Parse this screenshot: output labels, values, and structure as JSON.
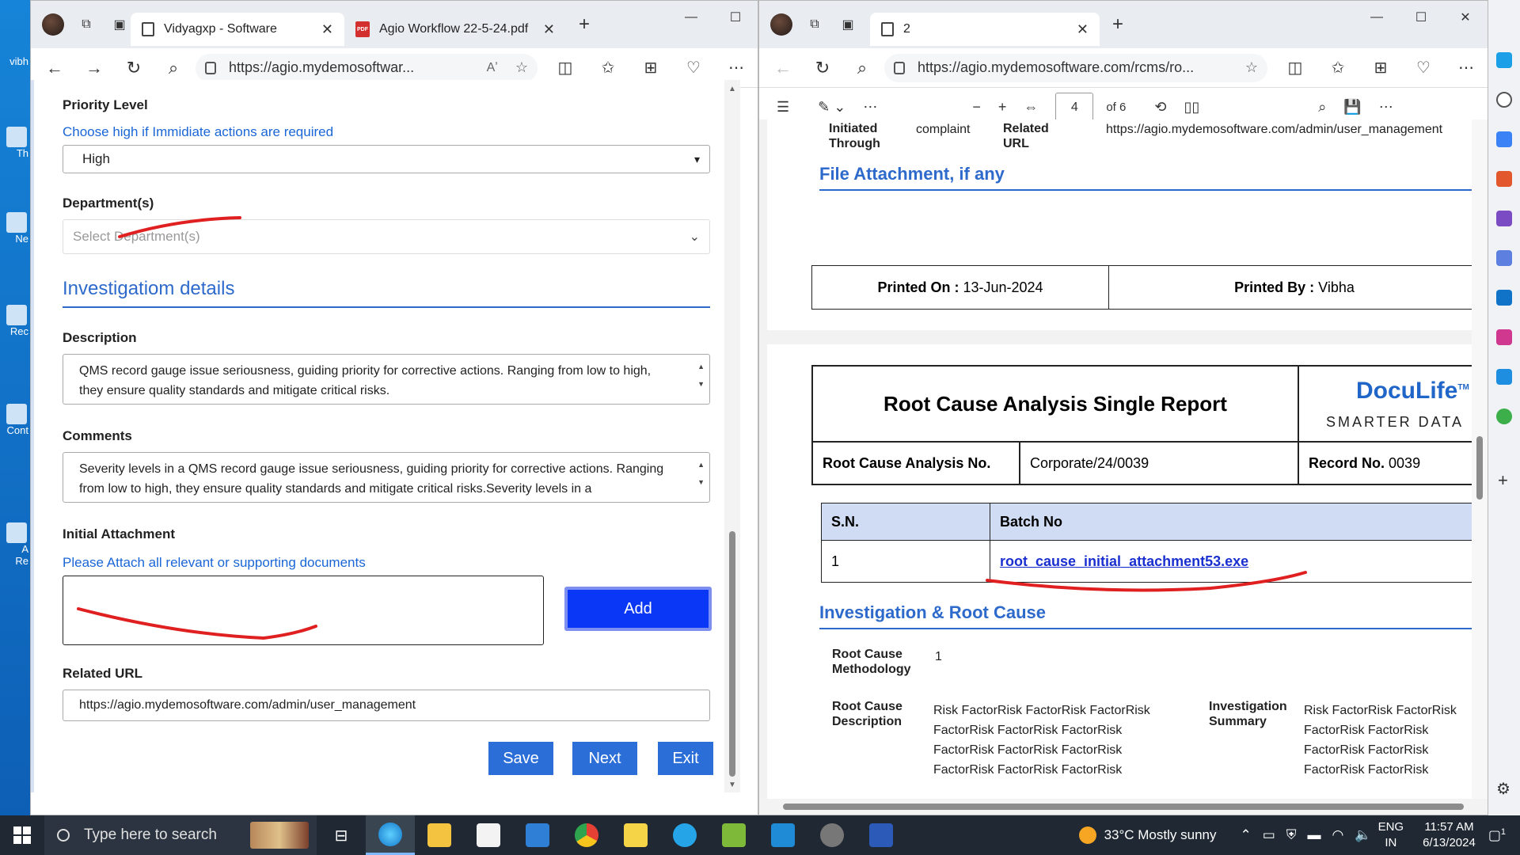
{
  "desktop": {
    "icons": [
      {
        "label": "vibh"
      },
      {
        "label": "Th"
      },
      {
        "label": "Ne"
      },
      {
        "label": "Rec"
      },
      {
        "label": "Cont"
      },
      {
        "label": "A"
      },
      {
        "label": "Re"
      }
    ]
  },
  "left_browser": {
    "tabs": [
      {
        "label": "Vidyagxp - Software",
        "close": "✕"
      },
      {
        "label": "Agio Workflow 22-5-24.pdf",
        "close": "✕"
      }
    ],
    "url": "https://agio.mydemosoftwar...",
    "form": {
      "priority_label": "Priority Level",
      "priority_hint": "Choose high if Immidiate actions are required",
      "priority_value": "High",
      "department_label": "Department(s)",
      "department_placeholder": "Select Department(s)",
      "section_title": "Investigatiom details",
      "description_label": "Description",
      "description_text": "QMS record gauge issue seriousness, guiding priority for corrective actions. Ranging from low to high, they ensure quality standards and mitigate critical risks.",
      "comments_label": "Comments",
      "comments_text": "Severity levels in a QMS record gauge issue seriousness, guiding priority for corrective actions. Ranging from low to high, they ensure quality standards and mitigate critical risks.Severity levels in a",
      "attachment_label": "Initial Attachment",
      "attachment_hint": "Please Attach all relevant or supporting documents",
      "add_button": "Add",
      "related_url_label": "Related URL",
      "related_url_value": "https://agio.mydemosoftware.com/admin/user_management",
      "save_button": "Save",
      "next_button": "Next",
      "exit_button": "Exit"
    }
  },
  "right_browser": {
    "tabs": [
      {
        "label": "2",
        "close": "✕"
      }
    ],
    "url": "https://agio.mydemosoftware.com/rcms/ro...",
    "pdf_toolbar": {
      "page_number": "4",
      "page_total": "of 6"
    },
    "pdf": {
      "initiated_through_label": "Initiated Through",
      "initiated_through_value": "complaint",
      "related_url_label": "Related URL",
      "related_url_value": "https://agio.mydemosoftware.com/admin/user_management",
      "file_attachment_title": "File Attachment, if any",
      "printed_on_label": "Printed On :",
      "printed_on_value": "13-Jun-2024",
      "printed_by_label": "Printed By :",
      "printed_by_value": "Vibha",
      "report_title": "Root Cause Analysis Single Report",
      "logo_name": "DocuLife",
      "logo_tm": "TM",
      "logo_tagline": "SMARTER DATA",
      "rca_no_label": "Root Cause Analysis No.",
      "rca_no_value": "Corporate/24/0039",
      "record_no_label": "Record No.",
      "record_no_value": "0039",
      "table_headers": [
        "S.N.",
        "Batch No"
      ],
      "table_rows": [
        [
          "1",
          "root_cause_initial_attachment53.exe"
        ]
      ],
      "investigation_title": "Investigation & Root Cause",
      "methodology_label": "Root Cause Methodology",
      "methodology_value": "1",
      "rc_description_label": "Root Cause Description",
      "rc_description_lines": [
        "Risk FactorRisk FactorRisk FactorRisk",
        "FactorRisk FactorRisk FactorRisk",
        "FactorRisk FactorRisk FactorRisk",
        "FactorRisk FactorRisk FactorRisk"
      ],
      "inv_summary_label": "Investigation Summary",
      "inv_summary_lines": [
        "Risk FactorRisk FactorRisk",
        "FactorRisk FactorRisk",
        "FactorRisk FactorRisk",
        "FactorRisk FactorRisk"
      ]
    }
  },
  "taskbar": {
    "search_placeholder": "Type here to search",
    "weather": "33°C  Mostly sunny",
    "lang_top": "ENG",
    "lang_bottom": "IN",
    "time": "11:57 AM",
    "date": "6/13/2024",
    "notification_count": "1"
  },
  "colors": {
    "accent_blue": "#2e6acb",
    "add_button": "#0a37f5",
    "annotation_red": "#e02020"
  }
}
